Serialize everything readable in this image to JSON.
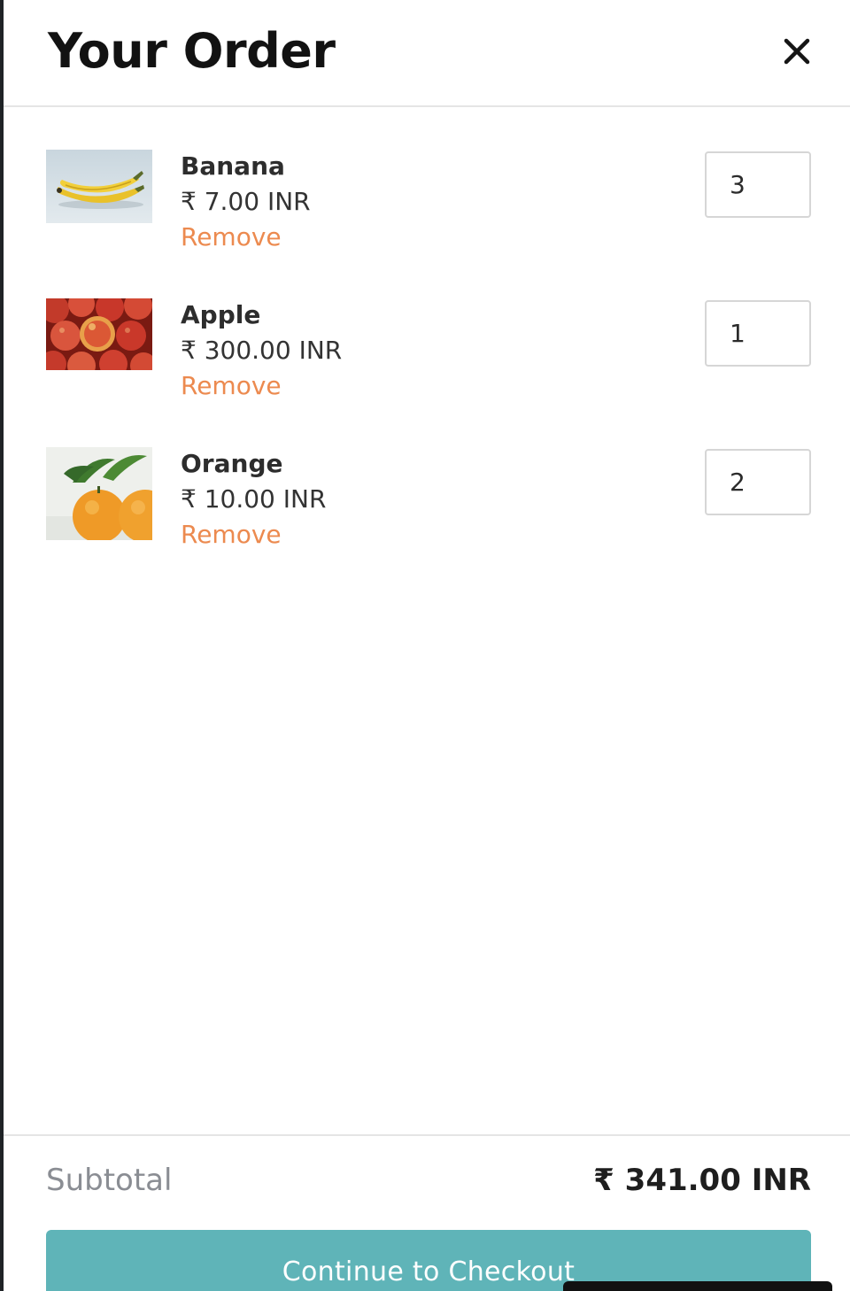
{
  "header": {
    "title": "Your Order",
    "close_icon": "close-icon"
  },
  "items": [
    {
      "name": "Banana",
      "price": "₹ 7.00 INR",
      "remove_label": "Remove",
      "quantity": "3",
      "image": "banana-image"
    },
    {
      "name": "Apple",
      "price": "₹ 300.00 INR",
      "remove_label": "Remove",
      "quantity": "1",
      "image": "apple-image"
    },
    {
      "name": "Orange",
      "price": "₹ 10.00 INR",
      "remove_label": "Remove",
      "quantity": "2",
      "image": "orange-image"
    }
  ],
  "footer": {
    "subtotal_label": "Subtotal",
    "subtotal_value": "₹ 341.00 INR",
    "checkout_label": "Continue to Checkout"
  },
  "colors": {
    "accent": "#5fb4b8",
    "remove": "#ec8a4f",
    "title": "#121212",
    "muted": "#8a8d93"
  }
}
